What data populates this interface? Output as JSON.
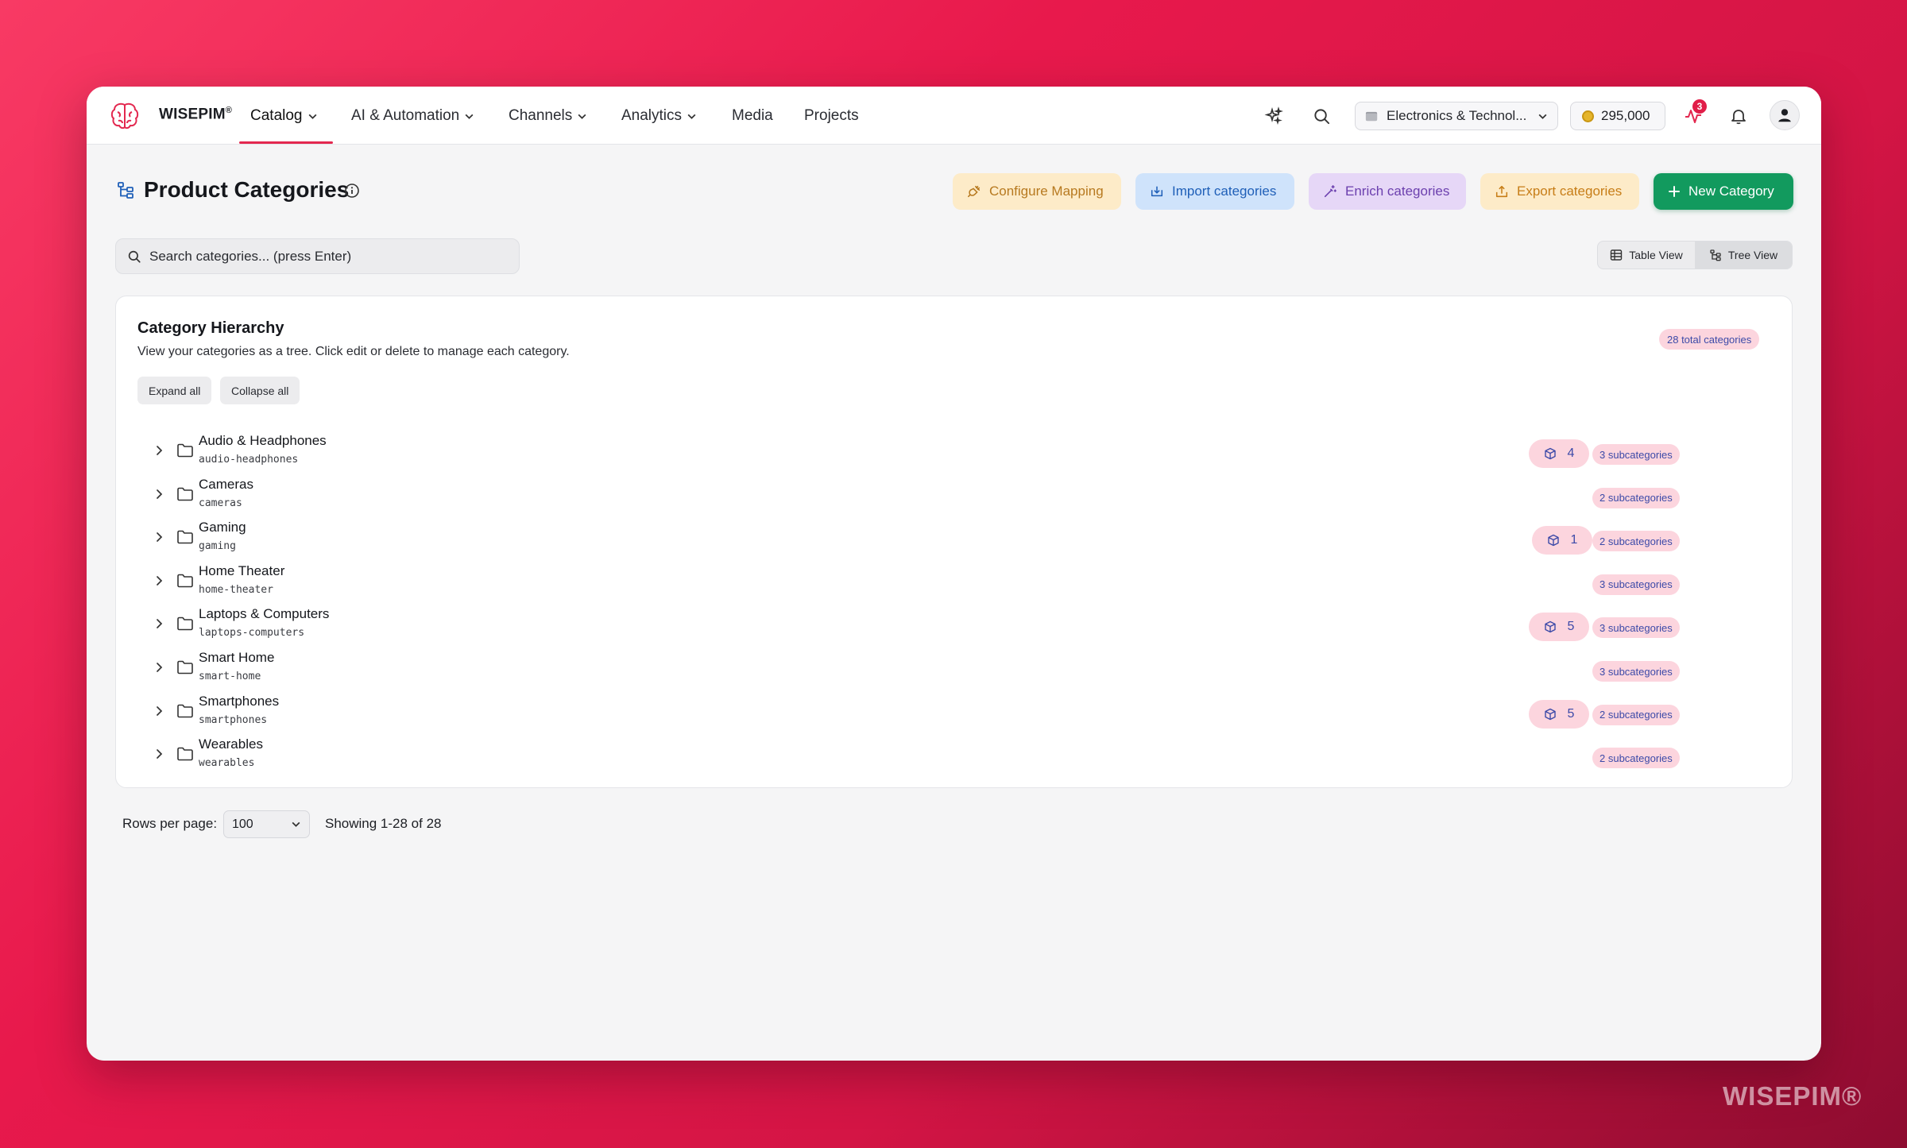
{
  "brand": {
    "name": "WISEPIM",
    "watermark": "WISEPIM®"
  },
  "nav": {
    "items": [
      {
        "label": "Catalog",
        "dropdown": true,
        "active": true
      },
      {
        "label": "AI & Automation",
        "dropdown": true
      },
      {
        "label": "Channels",
        "dropdown": true
      },
      {
        "label": "Analytics",
        "dropdown": true
      },
      {
        "label": "Media",
        "dropdown": false
      },
      {
        "label": "Projects",
        "dropdown": false
      }
    ],
    "workspace": "Electronics & Technol...",
    "credits": "295,000",
    "activity_badge": "3"
  },
  "page": {
    "title": "Product Categories",
    "actions": {
      "configure": "Configure Mapping",
      "import": "Import categories",
      "enrich": "Enrich categories",
      "export": "Export categories",
      "new": "New Category"
    },
    "search_placeholder": "Search categories... (press Enter)",
    "views": {
      "table": "Table View",
      "tree": "Tree View",
      "active": "tree"
    }
  },
  "card": {
    "title": "Category Hierarchy",
    "description": "View your categories as a tree. Click edit or delete to manage each category.",
    "total": "28 total categories",
    "expand_all": "Expand all",
    "collapse_all": "Collapse all",
    "categories": [
      {
        "name": "Audio & Headphones",
        "slug": "audio-headphones",
        "products": "4",
        "subcategories": "3 subcategories"
      },
      {
        "name": "Cameras",
        "slug": "cameras",
        "products": null,
        "subcategories": "2 subcategories"
      },
      {
        "name": "Gaming",
        "slug": "gaming",
        "products": "1",
        "subcategories": "2 subcategories"
      },
      {
        "name": "Home Theater",
        "slug": "home-theater",
        "products": null,
        "subcategories": "3 subcategories"
      },
      {
        "name": "Laptops & Computers",
        "slug": "laptops-computers",
        "products": "5",
        "subcategories": "3 subcategories"
      },
      {
        "name": "Smart Home",
        "slug": "smart-home",
        "products": null,
        "subcategories": "3 subcategories"
      },
      {
        "name": "Smartphones",
        "slug": "smartphones",
        "products": "5",
        "subcategories": "2 subcategories"
      },
      {
        "name": "Wearables",
        "slug": "wearables",
        "products": null,
        "subcategories": "2 subcategories"
      }
    ]
  },
  "pagination": {
    "rows_label": "Rows per page:",
    "rows_value": "100",
    "showing": "Showing 1-28 of 28"
  },
  "colors": {
    "accent": "#e3284f",
    "primary_button": "#129a5e",
    "badge_bg": "#fcd5de",
    "badge_text": "#3c4aa8"
  }
}
